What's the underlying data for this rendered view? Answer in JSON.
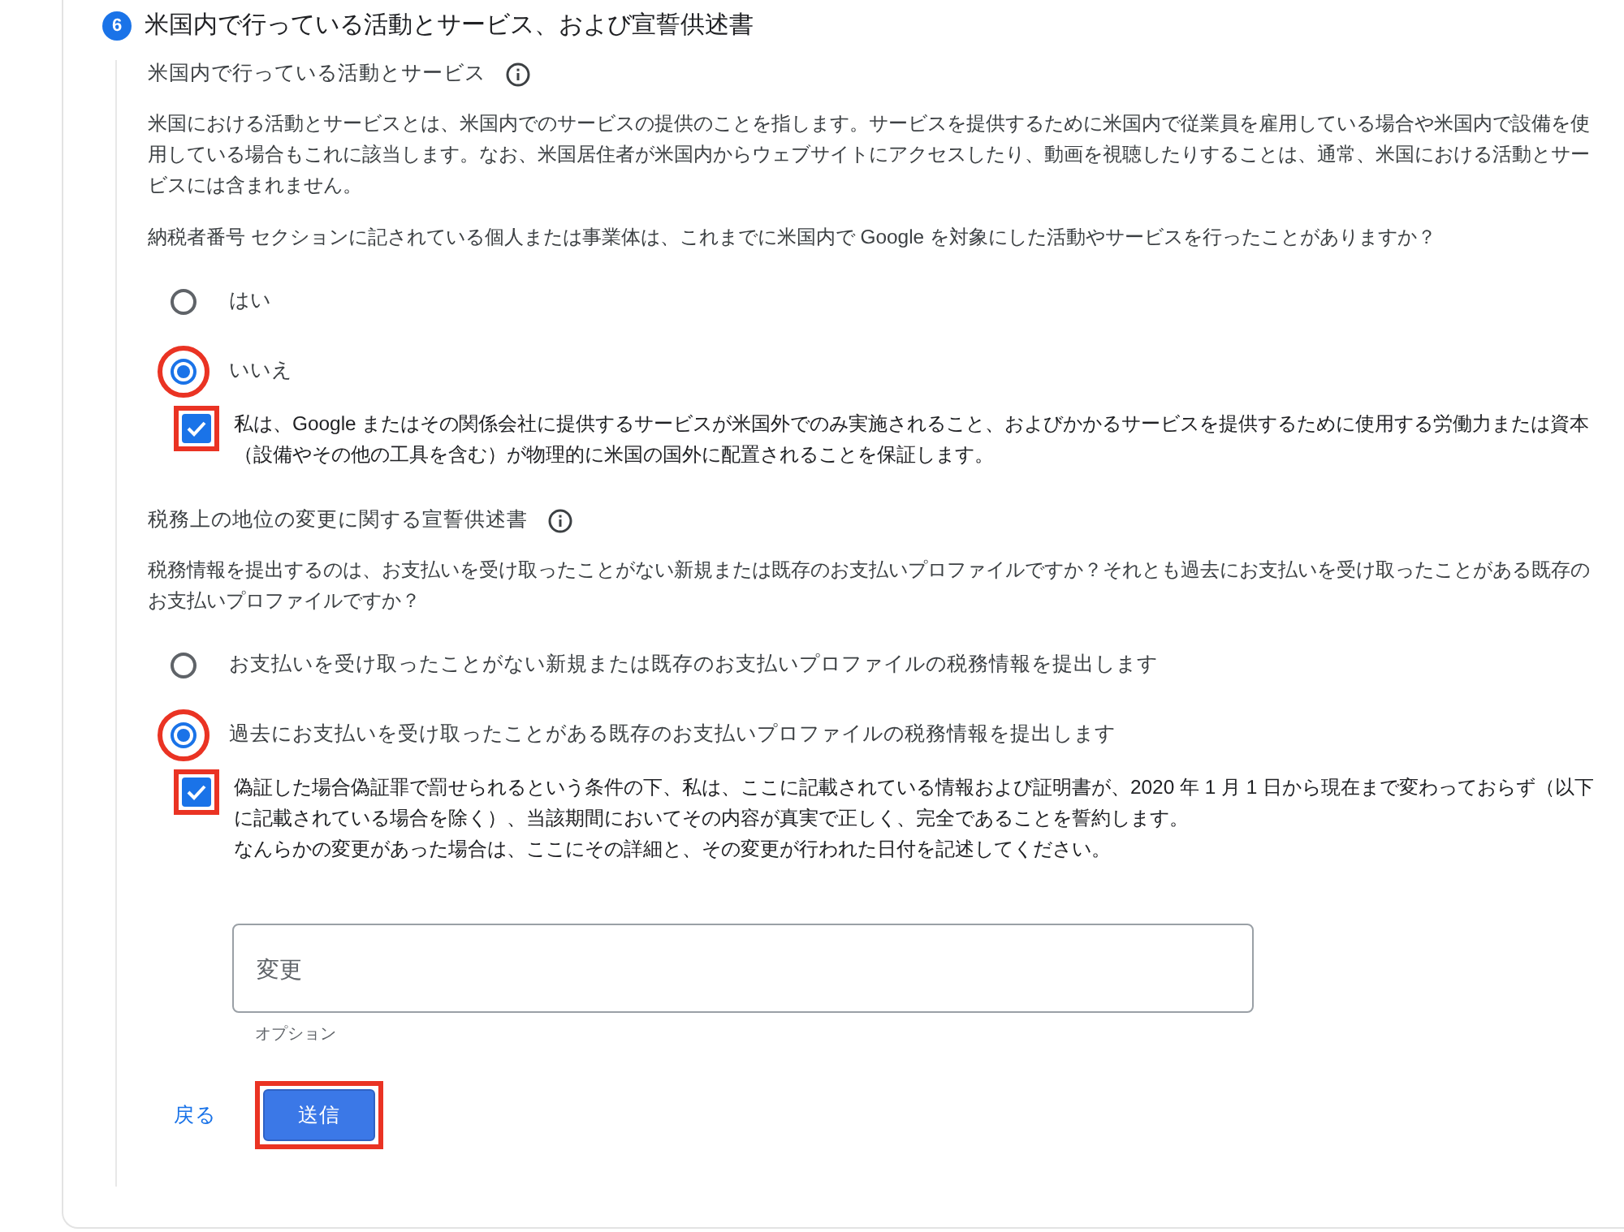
{
  "step": {
    "number": "6",
    "title": "米国内で行っている活動とサービス、および宣誓供述書"
  },
  "sections": [
    {
      "heading": "米国内で行っている活動とサービス",
      "paragraphs": [
        "米国における活動とサービスとは、米国内でのサービスの提供のことを指します。サービスを提供するために米国内で従業員を雇用している場合や米国内で設備を使用している場合もこれに該当します。なお、米国居住者が米国内からウェブサイトにアクセスしたり、動画を視聴したりすることは、通常、米国における活動とサービスには含まれません。",
        "納税者番号 セクションに記されている個人または事業体は、これまでに米国内で Google を対象にした活動やサービスを行ったことがありますか？"
      ],
      "options": [
        {
          "label": "はい",
          "selected": false,
          "highlighted": false
        },
        {
          "label": "いいえ",
          "selected": true,
          "highlighted": true
        }
      ],
      "confirmation": {
        "checked": true,
        "highlighted": true,
        "lines": [
          "私は、Google またはその関係会社に提供するサービスが米国外でのみ実施されること、およびかかるサービスを提供するために使用する労働力または資本（設備やその他の工具を含む）が物理的に米国の国外に配置されることを保証します。"
        ]
      }
    },
    {
      "heading": "税務上の地位の変更に関する宣誓供述書",
      "paragraphs": [
        "税務情報を提出するのは、お支払いを受け取ったことがない新規または既存のお支払いプロファイルですか？それとも過去にお支払いを受け取ったことがある既存のお支払いプロファイルですか？"
      ],
      "options": [
        {
          "label": "お支払いを受け取ったことがない新規または既存のお支払いプロファイルの税務情報を提出します",
          "selected": false,
          "highlighted": false
        },
        {
          "label": "過去にお支払いを受け取ったことがある既存のお支払いプロファイルの税務情報を提出します",
          "selected": true,
          "highlighted": true
        }
      ],
      "confirmation": {
        "checked": true,
        "highlighted": true,
        "lines": [
          "偽証した場合偽証罪で罰せられるという条件の下、私は、ここに記載されている情報および証明書が、2020 年 1 月 1 日から現在まで変わっておらず（以下に記載されている場合を除く）、当該期間においてその内容が真実で正しく、完全であることを誓約します。",
          "なんらかの変更があった場合は、ここにその詳細と、その変更が行われた日付を記述してください。"
        ]
      }
    }
  ],
  "changes_field": {
    "placeholder": "変更",
    "helper": "オプション"
  },
  "back_link": "戻る",
  "submit_button": {
    "label": "送信",
    "highlighted": true
  }
}
